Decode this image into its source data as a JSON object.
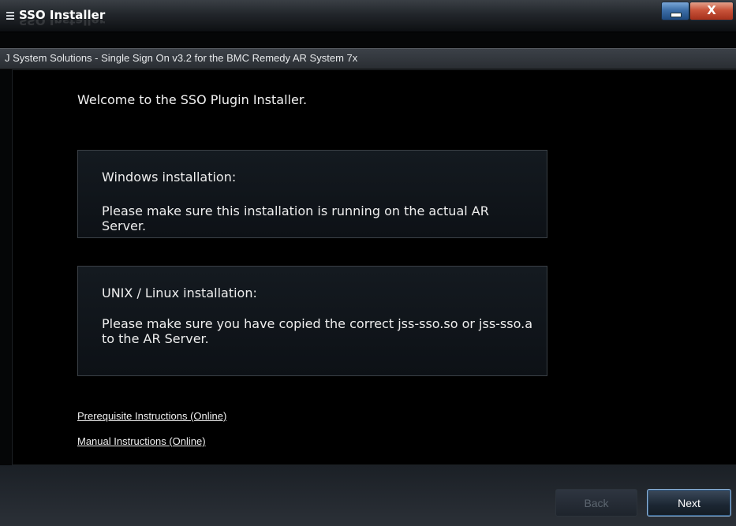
{
  "window": {
    "title": "SSO Installer",
    "menu_icon": "hamburger-icon",
    "minimize_icon": "minimize-icon",
    "close_label": "X"
  },
  "subtitle": "J System Solutions - Single Sign On v3.2 for the BMC Remedy AR System 7x",
  "main": {
    "welcome": "Welcome to the SSO Plugin Installer.",
    "windows_box": {
      "heading": "Windows installation:",
      "body": "Please make sure this installation is running on the actual AR Server."
    },
    "unix_box": {
      "heading": "UNIX / Linux installation:",
      "body": "Please make sure you have copied the correct jss-sso.so or jss-sso.a to the AR Server."
    },
    "links": {
      "prerequisite": "Prerequisite Instructions (Online)",
      "manual": "Manual Instructions (Online)"
    }
  },
  "footer": {
    "back_label": "Back",
    "next_label": "Next",
    "back_enabled": false
  },
  "colors": {
    "background": "#000000",
    "accent_border": "#8fb2d6",
    "close_button": "#c9543a",
    "minimize_button": "#3d6fa8"
  }
}
